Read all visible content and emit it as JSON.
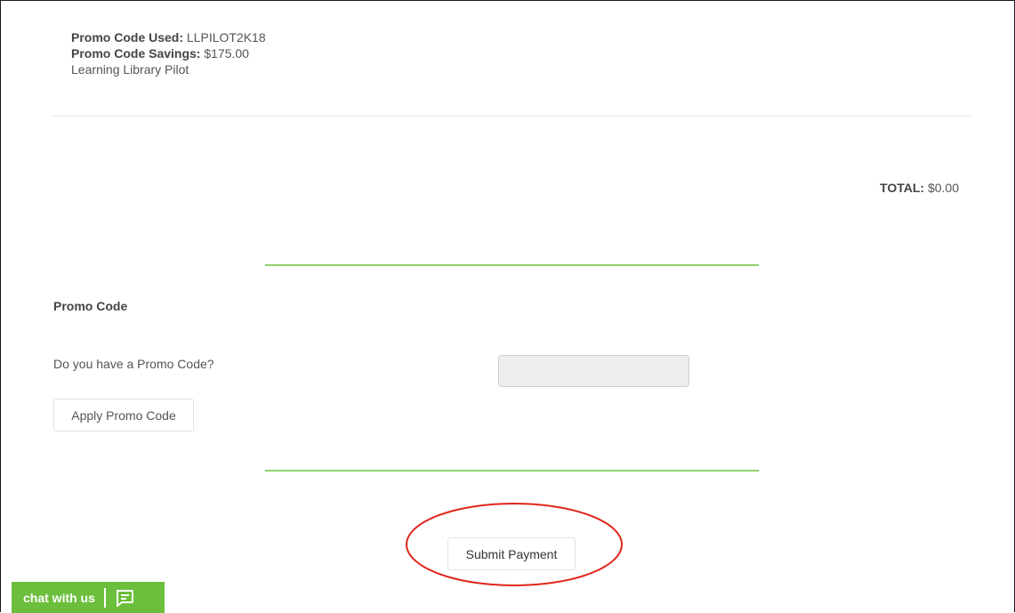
{
  "summary": {
    "promo_used_label": "Promo Code Used:",
    "promo_used_value": " LLPILOT2K18",
    "promo_savings_label": "Promo Code Savings:",
    "promo_savings_value": " $175.00",
    "promo_description": "Learning Library Pilot"
  },
  "total": {
    "label": "TOTAL:",
    "value": " $0.00"
  },
  "promo_section": {
    "title": "Promo Code",
    "question": "Do you have a Promo Code?",
    "input_value": "",
    "apply_label": "Apply Promo Code"
  },
  "payment": {
    "submit_label": "Submit Payment"
  },
  "chat": {
    "label": "chat with us",
    "icon": "chat-bubble-icon"
  },
  "colors": {
    "accent_green": "#8ed26a",
    "chat_green": "#6cbf3c",
    "annotation_red": "#e0251b"
  }
}
